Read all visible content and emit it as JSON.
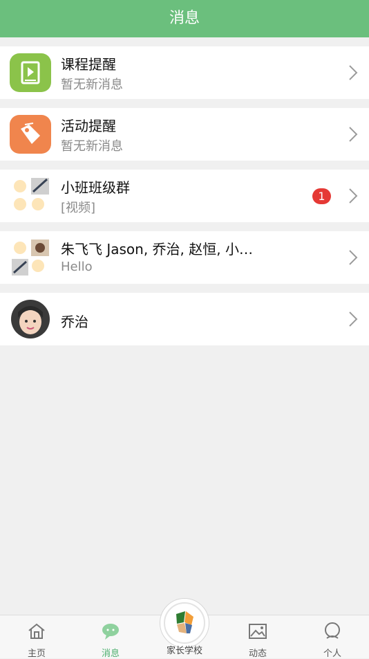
{
  "header": {
    "title": "消息"
  },
  "messages": [
    {
      "title": "课程提醒",
      "subtitle": "暂无新消息",
      "icon": "play-book-icon",
      "color": "#8bc34a"
    },
    {
      "title": "活动提醒",
      "subtitle": "暂无新消息",
      "icon": "tag-icon",
      "color": "#f0854d"
    },
    {
      "title": "小班班级群",
      "subtitle": "[视频]",
      "icon": "group-avatar-icon",
      "badge": "1"
    },
    {
      "title": "朱飞飞 Jason, 乔治, 赵恒, 小…",
      "subtitle": "Hello",
      "icon": "group-avatar-icon"
    },
    {
      "title": "乔治",
      "subtitle": "",
      "icon": "child-avatar-icon"
    }
  ],
  "tabbar": {
    "home": "主页",
    "messages": "消息",
    "school": "家长学校",
    "feed": "动态",
    "profile": "个人"
  },
  "colors": {
    "accent": "#6bbf7d",
    "badge": "#e53935"
  }
}
